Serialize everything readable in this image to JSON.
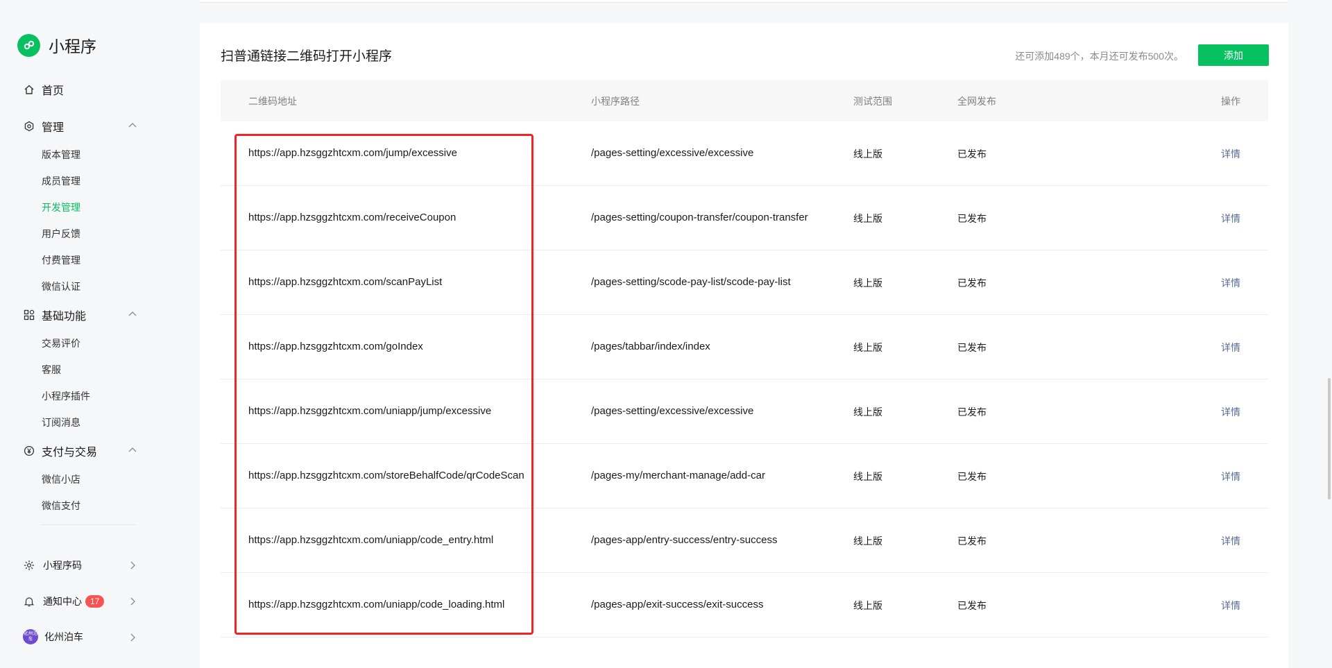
{
  "app": {
    "name": "小程序"
  },
  "nav": {
    "home": "首页",
    "manage": "管理",
    "manage_items": [
      "版本管理",
      "成员管理",
      "开发管理",
      "用户反馈",
      "付费管理",
      "微信认证"
    ],
    "basic": "基础功能",
    "basic_items": [
      "交易评价",
      "客服",
      "小程序插件",
      "订阅消息"
    ],
    "pay": "支付与交易",
    "pay_items": [
      "微信小店",
      "微信支付"
    ],
    "bottom": {
      "qrcode": "小程序码",
      "notify": "通知中心",
      "notify_count": "17",
      "account": "化州泊车",
      "avatar_text": "化州泊车"
    }
  },
  "main": {
    "title": "扫普通链接二维码打开小程序",
    "quota": "还可添加489个，本月还可发布500次。",
    "add_button": "添加",
    "columns": [
      "二维码地址",
      "小程序路径",
      "测试范围",
      "全网发布",
      "操作"
    ],
    "rows": [
      {
        "url": "https://app.hzsggzhtcxm.com/jump/excessive",
        "path": "/pages-setting/excessive/excessive",
        "scope": "线上版",
        "status": "已发布",
        "action": "详情"
      },
      {
        "url": "https://app.hzsggzhtcxm.com/receiveCoupon",
        "path": "/pages-setting/coupon-transfer/coupon-transfer",
        "scope": "线上版",
        "status": "已发布",
        "action": "详情"
      },
      {
        "url": "https://app.hzsggzhtcxm.com/scanPayList",
        "path": "/pages-setting/scode-pay-list/scode-pay-list",
        "scope": "线上版",
        "status": "已发布",
        "action": "详情"
      },
      {
        "url": "https://app.hzsggzhtcxm.com/goIndex",
        "path": "/pages/tabbar/index/index",
        "scope": "线上版",
        "status": "已发布",
        "action": "详情"
      },
      {
        "url": "https://app.hzsggzhtcxm.com/uniapp/jump/excessive",
        "path": "/pages-setting/excessive/excessive",
        "scope": "线上版",
        "status": "已发布",
        "action": "详情"
      },
      {
        "url": "https://app.hzsggzhtcxm.com/storeBehalfCode/qrCodeScan",
        "path": "/pages-my/merchant-manage/add-car",
        "scope": "线上版",
        "status": "已发布",
        "action": "详情"
      },
      {
        "url": "https://app.hzsggzhtcxm.com/uniapp/code_entry.html",
        "path": "/pages-app/entry-success/entry-success",
        "scope": "线上版",
        "status": "已发布",
        "action": "详情"
      },
      {
        "url": "https://app.hzsggzhtcxm.com/uniapp/code_loading.html",
        "path": "/pages-app/exit-success/exit-success",
        "scope": "线上版",
        "status": "已发布",
        "action": "详情"
      }
    ]
  },
  "colors": {
    "brand": "#07c160",
    "link": "#576b95",
    "badge": "#fa5151",
    "highlight": "#f02424"
  },
  "icons": [
    "miniprogram-logo-icon",
    "home-icon",
    "settings-icon",
    "grid-icon",
    "yuan-icon",
    "chevron-up-icon",
    "qrcode-sun-icon",
    "bell-icon",
    "chevron-right-icon"
  ]
}
